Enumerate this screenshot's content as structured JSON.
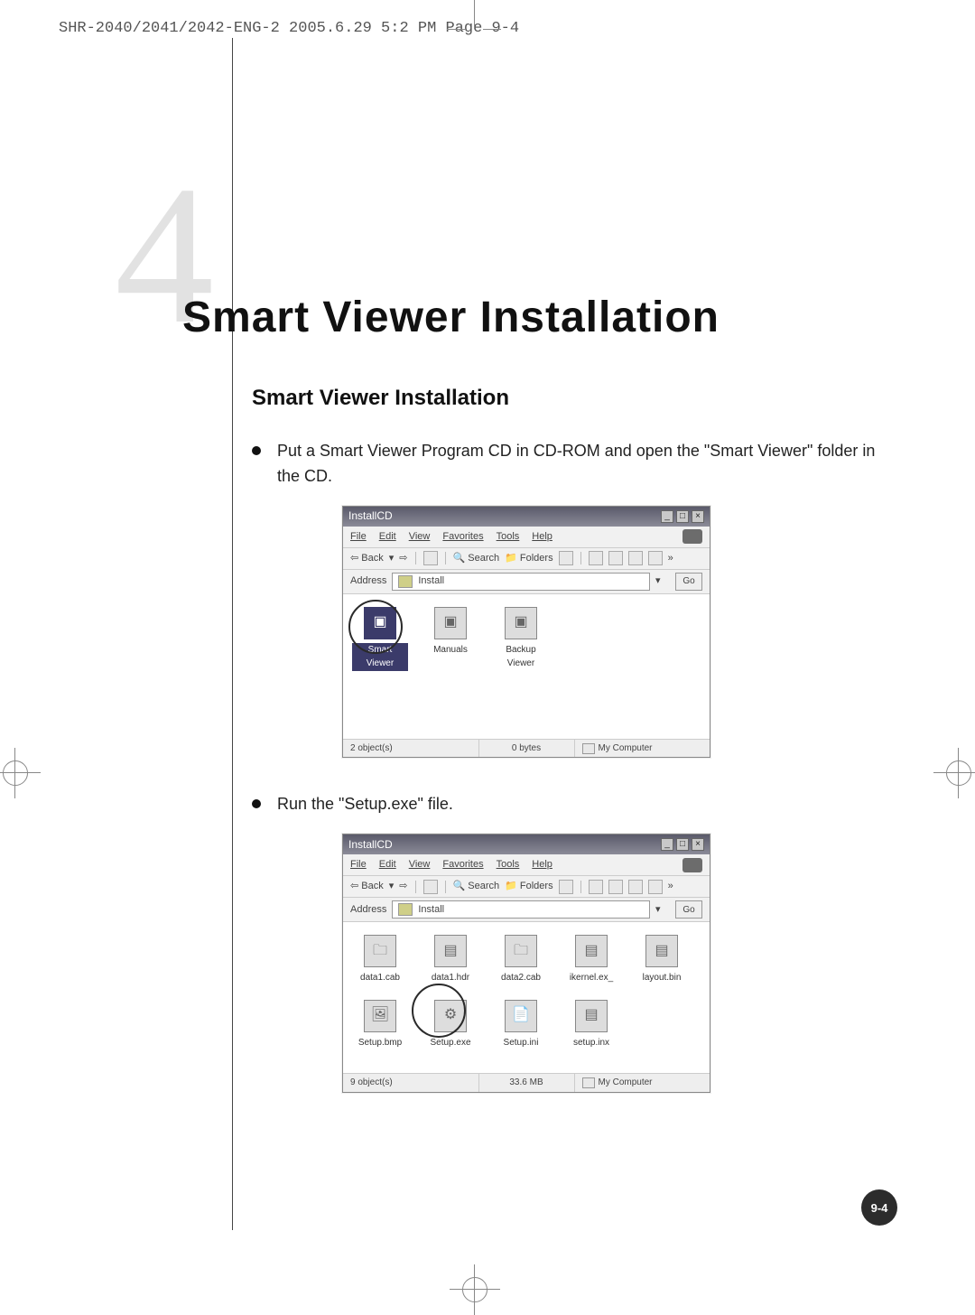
{
  "header_meta": "SHR-2040/2041/2042-ENG-2  2005.6.29  5:2 PM  Page 9-4",
  "chapter_number": "4",
  "title": "Smart Viewer Installation",
  "subtitle": "Smart Viewer Installation",
  "bullets": {
    "b1": "Put a Smart Viewer Program CD in CD-ROM and open the \"Smart Viewer\" folder in the CD.",
    "b2": "Run the \"Setup.exe\" file."
  },
  "page_number": "9-4",
  "window": {
    "title": "InstallCD",
    "menus": {
      "file": "File",
      "edit": "Edit",
      "view": "View",
      "favorites": "Favorites",
      "tools": "Tools",
      "help": "Help"
    },
    "toolbar": {
      "back": "Back",
      "search": "Search",
      "folders": "Folders"
    },
    "address_label": "Address",
    "go_label": "Go"
  },
  "shot1": {
    "address_value": "Install",
    "items": {
      "smart_viewer": "Smart Viewer",
      "manuals": "Manuals",
      "backup_viewer": "Backup Viewer"
    },
    "status": {
      "left": "2 object(s)",
      "center": "0 bytes",
      "right": "My Computer"
    }
  },
  "shot2": {
    "address_value": "Install",
    "items": {
      "data1_cab": "data1.cab",
      "data1_hdr": "data1.hdr",
      "data2_cab": "data2.cab",
      "ikernel_ex": "ikernel.ex_",
      "layout_bin": "layout.bin",
      "setup_bmp": "Setup.bmp",
      "setup_exe": "Setup.exe",
      "setup_ini": "Setup.ini",
      "setup_inx": "setup.inx"
    },
    "status": {
      "left": "9 object(s)",
      "center": "33.6 MB",
      "right": "My Computer"
    }
  }
}
